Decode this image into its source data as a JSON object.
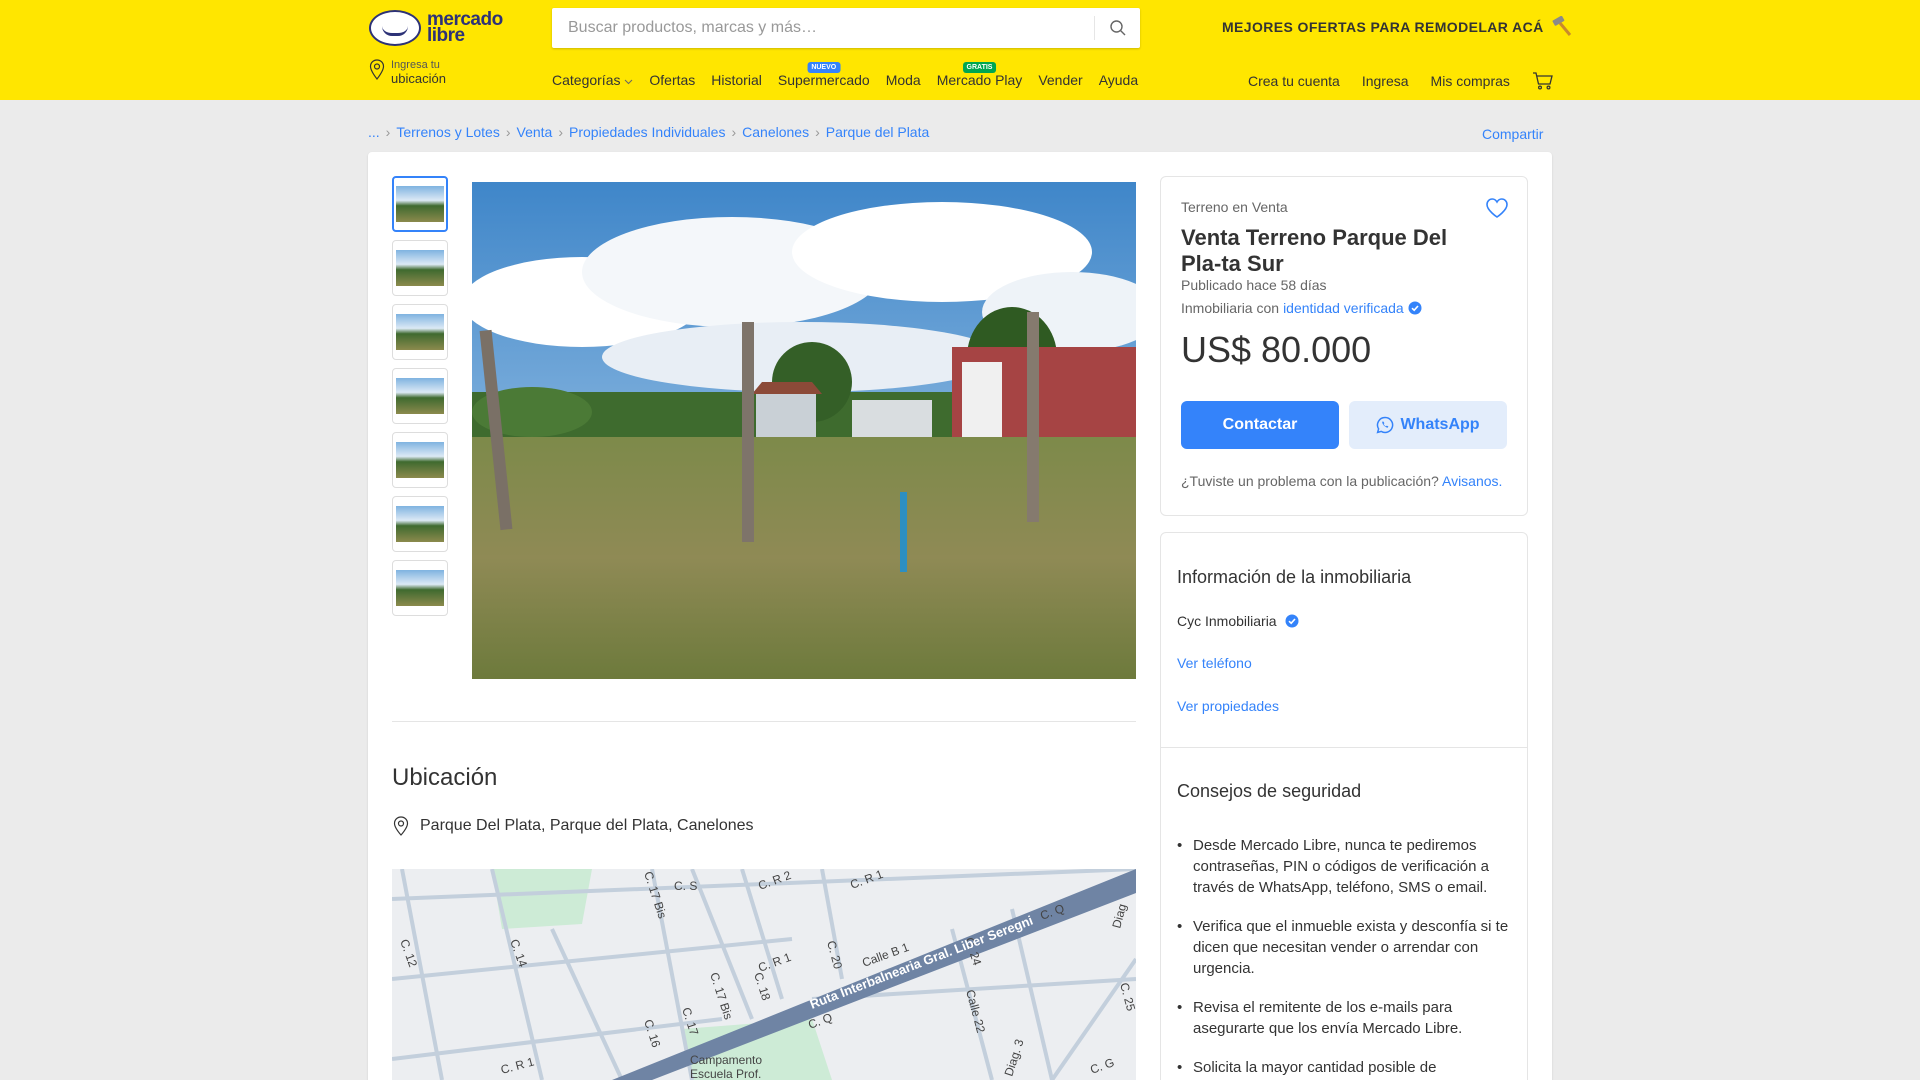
{
  "header": {
    "logo_line1": "mercado",
    "logo_line2": "libre",
    "search_placeholder": "Buscar productos, marcas y más…",
    "promo": "MEJORES OFERTAS PARA REMODELAR ACÁ",
    "location_small": "Ingresa tu",
    "location_big": "ubicación",
    "nav": {
      "categorias": "Categorías",
      "ofertas": "Ofertas",
      "historial": "Historial",
      "supermercado": "Supermercado",
      "supermercado_badge": "NUEVO",
      "moda": "Moda",
      "mercado_play": "Mercado Play",
      "mercado_play_badge": "GRATIS",
      "vender": "Vender",
      "ayuda": "Ayuda"
    },
    "user": {
      "crea_cuenta": "Crea tu cuenta",
      "ingresa": "Ingresa",
      "mis_compras": "Mis compras"
    }
  },
  "breadcrumb": {
    "ellipsis": "...",
    "items": [
      "Terrenos y Lotes",
      "Venta",
      "Propiedades Individuales",
      "Canelones",
      "Parque del Plata"
    ],
    "share": "Compartir"
  },
  "listing": {
    "condition": "Terreno en Venta",
    "title": "Venta Terreno Parque Del Pla-ta Sur",
    "published": "Publicado hace 58 días",
    "agency_prefix": "Inmobiliaria con",
    "agency_link": "identidad verificada",
    "price": "US$ 80.000",
    "contact_button": "Contactar",
    "whatsapp_button": "WhatsApp",
    "problem_text": "¿Tuviste un problema con la publicación?",
    "problem_link": "Avisanos."
  },
  "location": {
    "title": "Ubicación",
    "address": "Parque Del Plata, Parque del Plata, Canelones",
    "map_labels": {
      "c12": "C. 12",
      "c14": "C. 14",
      "c16": "C. 16",
      "c17": "C. 17",
      "c17bis": "C. 17 Bis",
      "c17bis2": "C. 17 Bis",
      "c18": "C. 18",
      "c20": "C. 20",
      "c24": "C. 24",
      "c25": "C. 25",
      "cs": "C. S",
      "cr2": "C. R 2",
      "cr1a": "C. R 1",
      "cr1b": "C. R 1",
      "cr1c": "C. R 1",
      "cq": "C. Q",
      "cq2": "C. Q",
      "cg": "C. G",
      "calleb1": "Calle B 1",
      "calle22": "Calle 22",
      "diag": "Diag",
      "diag3": "Diag. 3",
      "ruta": "Ruta Interbalnearia Gral. Liber Seregni",
      "camp1": "Campamento",
      "camp2": "Escuela Prof."
    }
  },
  "agency_info": {
    "title": "Información de la inmobiliaria",
    "name": "Cyc Inmobiliaria",
    "phone_link": "Ver teléfono",
    "properties_link": "Ver propiedades"
  },
  "safety": {
    "title": "Consejos de seguridad",
    "tips": [
      "Desde Mercado Libre, nunca te pediremos contraseñas, PIN o códigos de verificación a través de WhatsApp, teléfono, SMS o email.",
      "Verifica que el inmueble exista y desconfía si te dicen que necesitan vender o arrendar con urgencia.",
      "Revisa el remitente de los e-mails para asegurarte que los envía Mercado Libre.",
      "Solicita la mayor cantidad posible de"
    ]
  },
  "colors": {
    "brand_yellow": "#ffe600",
    "link_blue": "#3483fa",
    "verified_blue": "#3483fa"
  }
}
